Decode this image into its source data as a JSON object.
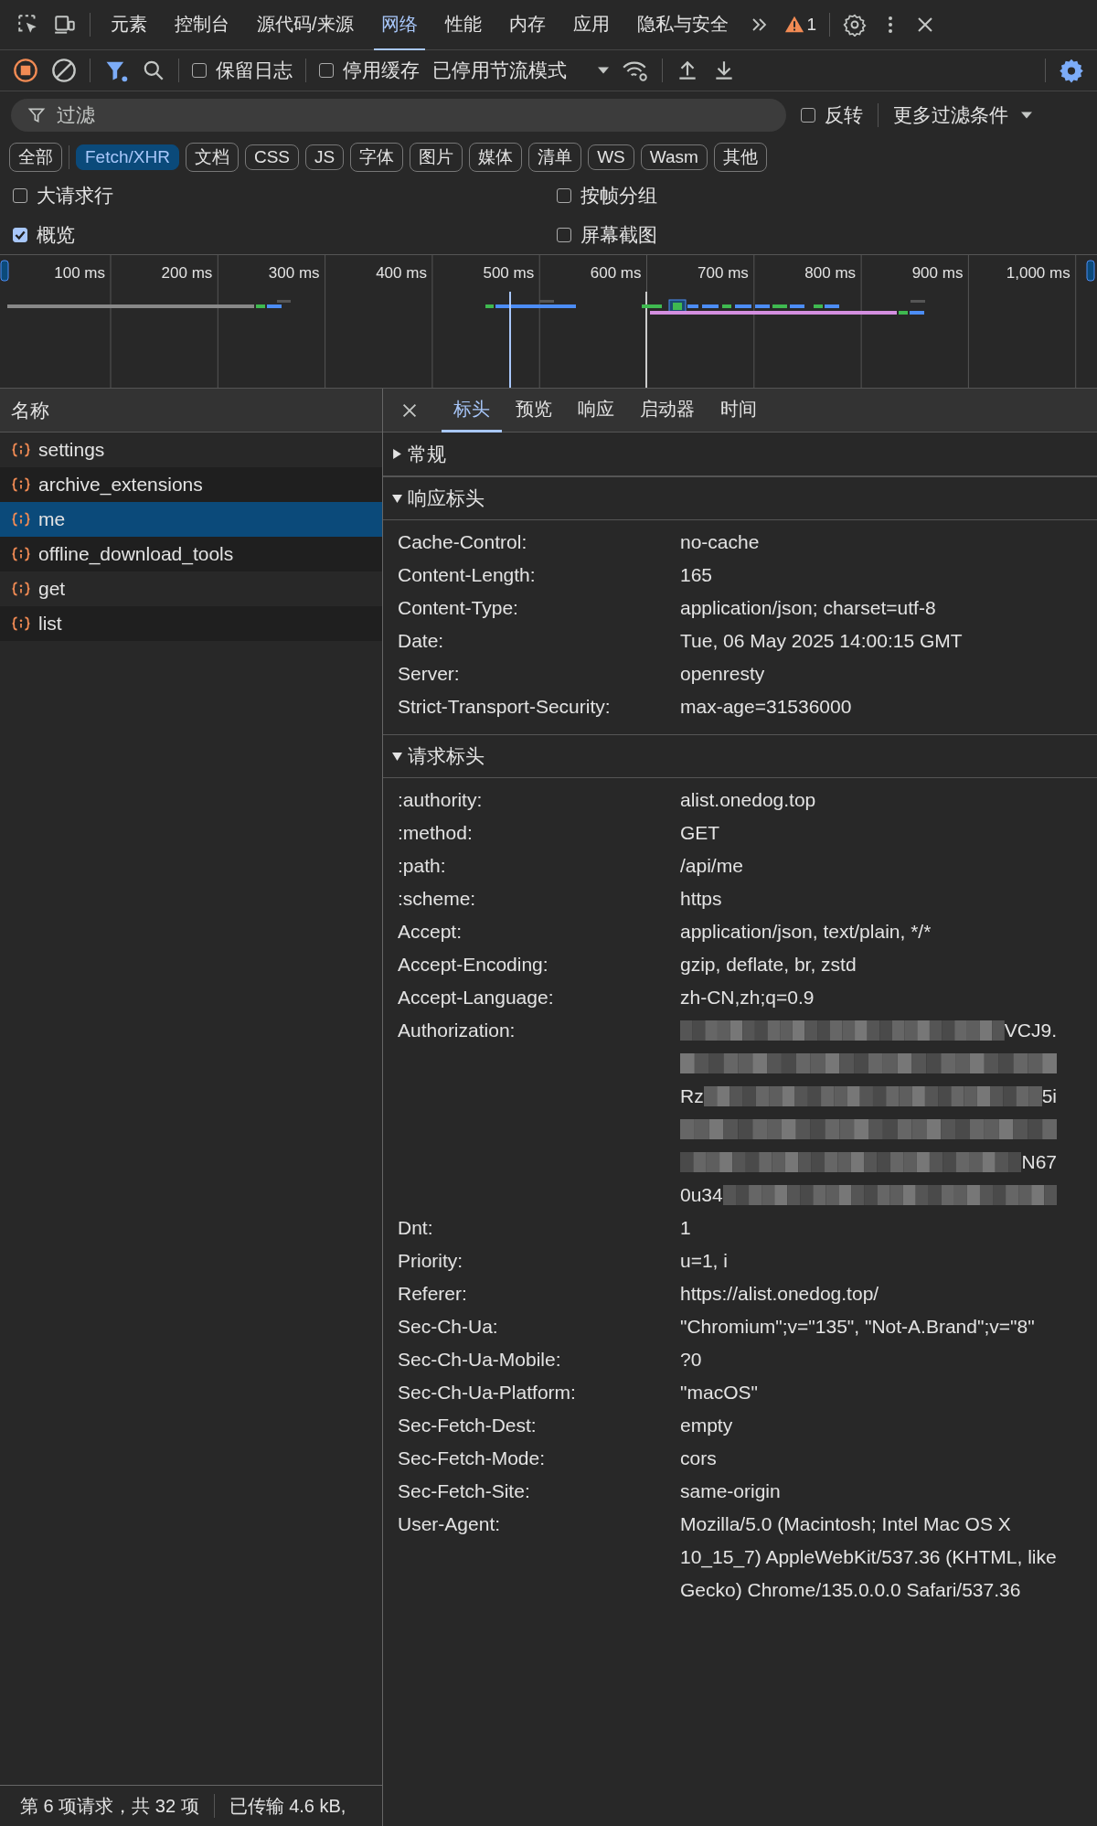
{
  "main_tabs": [
    {
      "label": "元素",
      "selected": false
    },
    {
      "label": "控制台",
      "selected": false
    },
    {
      "label": "源代码/来源",
      "selected": false
    },
    {
      "label": "网络",
      "selected": true
    },
    {
      "label": "性能",
      "selected": false
    },
    {
      "label": "内存",
      "selected": false
    },
    {
      "label": "应用",
      "selected": false
    },
    {
      "label": "隐私与安全",
      "selected": false
    }
  ],
  "warning_count": "1",
  "toolbar": {
    "recording": true,
    "filter_active": true,
    "preserve_log": {
      "label": "保留日志",
      "checked": false
    },
    "disable_cache": {
      "label": "停用缓存",
      "checked": false
    },
    "throttling": "已停用节流模式"
  },
  "filter": {
    "placeholder": "过滤",
    "invert": {
      "label": "反转",
      "checked": false
    },
    "more_filters": "更多过滤条件"
  },
  "type_chips": [
    {
      "label": "全部",
      "selected": false
    },
    {
      "label": "Fetch/XHR",
      "selected": true
    },
    {
      "label": "文档",
      "selected": false
    },
    {
      "label": "CSS",
      "selected": false
    },
    {
      "label": "JS",
      "selected": false
    },
    {
      "label": "字体",
      "selected": false
    },
    {
      "label": "图片",
      "selected": false
    },
    {
      "label": "媒体",
      "selected": false
    },
    {
      "label": "清单",
      "selected": false
    },
    {
      "label": "WS",
      "selected": false
    },
    {
      "label": "Wasm",
      "selected": false
    },
    {
      "label": "其他",
      "selected": false
    }
  ],
  "options": [
    {
      "label": "大请求行",
      "checked": false
    },
    {
      "label": "按帧分组",
      "checked": false
    },
    {
      "label": "概览",
      "checked": true
    },
    {
      "label": "屏幕截图",
      "checked": false
    }
  ],
  "timeline": {
    "ticks": [
      "100 ms",
      "200 ms",
      "300 ms",
      "400 ms",
      "500 ms",
      "600 ms",
      "700 ms",
      "800 ms",
      "900 ms",
      "1,000 ms"
    ]
  },
  "request_list": {
    "column": "名称",
    "items": [
      {
        "name": "settings",
        "selected": false
      },
      {
        "name": "archive_extensions",
        "selected": false
      },
      {
        "name": "me",
        "selected": true
      },
      {
        "name": "offline_download_tools",
        "selected": false
      },
      {
        "name": "get",
        "selected": false
      },
      {
        "name": "list",
        "selected": false
      }
    ]
  },
  "detail_tabs": [
    {
      "label": "标头",
      "selected": true
    },
    {
      "label": "预览",
      "selected": false
    },
    {
      "label": "响应",
      "selected": false
    },
    {
      "label": "启动器",
      "selected": false
    },
    {
      "label": "时间",
      "selected": false
    }
  ],
  "sections": [
    {
      "title": "常规",
      "expanded": false
    },
    {
      "title": "响应标头",
      "expanded": true,
      "headers": [
        {
          "name": "Cache-Control:",
          "value": "no-cache"
        },
        {
          "name": "Content-Length:",
          "value": "165"
        },
        {
          "name": "Content-Type:",
          "value": "application/json; charset=utf-8"
        },
        {
          "name": "Date:",
          "value": "Tue, 06 May 2025 14:00:15 GMT"
        },
        {
          "name": "Server:",
          "value": "openresty"
        },
        {
          "name": "Strict-Transport-Security:",
          "value": "max-age=31536000"
        }
      ]
    },
    {
      "title": "请求标头",
      "expanded": true,
      "headers": [
        {
          "name": ":authority:",
          "value": "alist.onedog.top"
        },
        {
          "name": ":method:",
          "value": "GET"
        },
        {
          "name": ":path:",
          "value": "/api/me"
        },
        {
          "name": ":scheme:",
          "value": "https"
        },
        {
          "name": "Accept:",
          "value": "application/json, text/plain, */*"
        },
        {
          "name": "Accept-Encoding:",
          "value": "gzip, deflate, br, zstd"
        },
        {
          "name": "Accept-Language:",
          "value": "zh-CN,zh;q=0.9"
        },
        {
          "name": "Authorization:",
          "redacted_lines": [
            {
              "kind": "masked",
              "end": "VCJ9."
            },
            {
              "kind": "masked"
            },
            {
              "kind": "masked",
              "start": "Rz",
              "end": "5i"
            },
            {
              "kind": "masked"
            },
            {
              "kind": "masked",
              "end": "N67"
            },
            {
              "kind": "masked",
              "start": "0u34"
            }
          ]
        },
        {
          "name": "Dnt:",
          "value": "1"
        },
        {
          "name": "Priority:",
          "value": "u=1, i"
        },
        {
          "name": "Referer:",
          "value": "https://alist.onedog.top/"
        },
        {
          "name": "Sec-Ch-Ua:",
          "value": "\"Chromium\";v=\"135\", \"Not-A.Brand\";v=\"8\""
        },
        {
          "name": "Sec-Ch-Ua-Mobile:",
          "value": "?0"
        },
        {
          "name": "Sec-Ch-Ua-Platform:",
          "value": "\"macOS\""
        },
        {
          "name": "Sec-Fetch-Dest:",
          "value": "empty"
        },
        {
          "name": "Sec-Fetch-Mode:",
          "value": "cors"
        },
        {
          "name": "Sec-Fetch-Site:",
          "value": "same-origin"
        },
        {
          "name": "User-Agent:",
          "value": "Mozilla/5.0 (Macintosh; Intel Mac OS X 10_15_7) AppleWebKit/537.36 (KHTML, like Gecko) Chrome/135.0.0.0 Safari/537.36"
        }
      ]
    }
  ],
  "status_bar": {
    "requests": "第 6 项请求，共 32 项",
    "transferred": "已传输 4.6 kB,"
  }
}
